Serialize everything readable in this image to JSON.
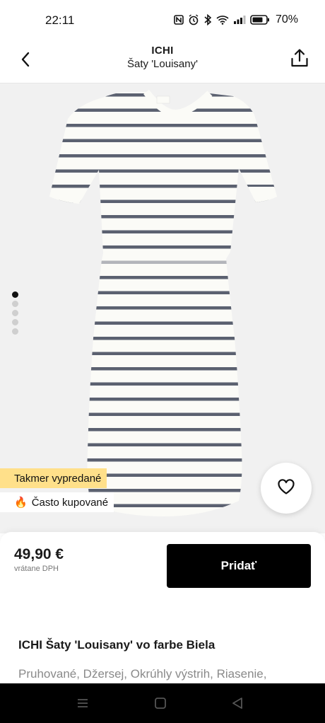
{
  "status_bar": {
    "time": "22:11",
    "battery_percent": "70%",
    "icons": [
      "nfc-icon",
      "alarm-icon",
      "bluetooth-icon",
      "wifi-icon",
      "signal-icon",
      "battery-icon"
    ]
  },
  "header": {
    "brand": "ICHI",
    "product_name": "Šaty 'Louisany'",
    "back_icon": "chevron-left-icon",
    "share_icon": "share-icon"
  },
  "gallery": {
    "image_count": 5,
    "active_index": 0,
    "badges": {
      "sold_out": "Takmer vypredané",
      "popular_emoji": "🔥",
      "popular": "Často kupované"
    },
    "favorite_icon": "heart-icon"
  },
  "purchase": {
    "price": "49,90 €",
    "vat_note": "vrátane DPH",
    "add_button": "Pridať"
  },
  "details": {
    "title": "ICHI Šaty 'Louisany' vo farbe Biela",
    "features": "Pruhované, Džersej, Okrúhly výstrih, Riasenie,"
  },
  "colors": {
    "accent_badge": "#ffe08a",
    "button": "#000000",
    "stripe": "#5b6170"
  }
}
